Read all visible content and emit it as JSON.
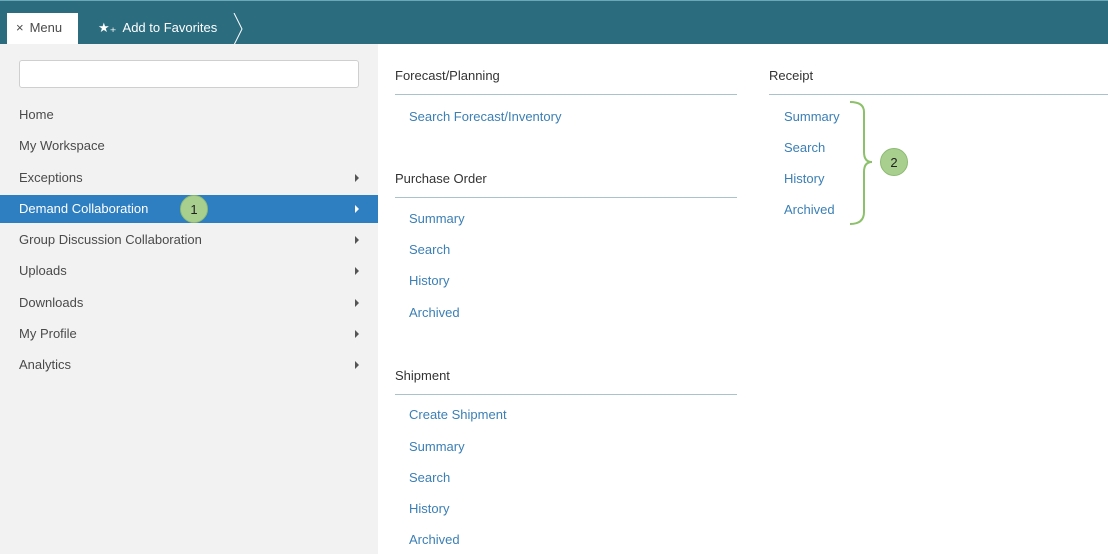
{
  "topbar": {
    "menu_label": "Menu",
    "close_glyph": "×",
    "favorites_label": "Add to Favorites",
    "favorites_glyph": "★₊"
  },
  "search": {
    "placeholder": "",
    "value": ""
  },
  "nav": {
    "items": [
      {
        "label": "Home",
        "has_submenu": false
      },
      {
        "label": "My Workspace",
        "has_submenu": false
      },
      {
        "label": "Exceptions",
        "has_submenu": true
      },
      {
        "label": "Demand Collaboration",
        "has_submenu": true,
        "active": true
      },
      {
        "label": "Group Discussion Collaboration",
        "has_submenu": true
      },
      {
        "label": "Uploads",
        "has_submenu": true
      },
      {
        "label": "Downloads",
        "has_submenu": true
      },
      {
        "label": "My Profile",
        "has_submenu": true
      },
      {
        "label": "Analytics",
        "has_submenu": true
      }
    ]
  },
  "callouts": {
    "one": "1",
    "two": "2"
  },
  "sections": {
    "forecast": {
      "header": "Forecast/Planning",
      "links": [
        "Search Forecast/Inventory"
      ]
    },
    "purchase_order": {
      "header": "Purchase Order",
      "links": [
        "Summary",
        "Search",
        "History",
        "Archived"
      ]
    },
    "shipment": {
      "header": "Shipment",
      "links": [
        "Create Shipment",
        "Summary",
        "Search",
        "History",
        "Archived"
      ]
    },
    "receipt": {
      "header": "Receipt",
      "links": [
        "Summary",
        "Search",
        "History",
        "Archived"
      ]
    }
  },
  "colors": {
    "topbar": "#2b6c7f",
    "active_nav": "#2e7ec2",
    "link": "#3b7fb5",
    "callout": "#a9cf8f"
  }
}
